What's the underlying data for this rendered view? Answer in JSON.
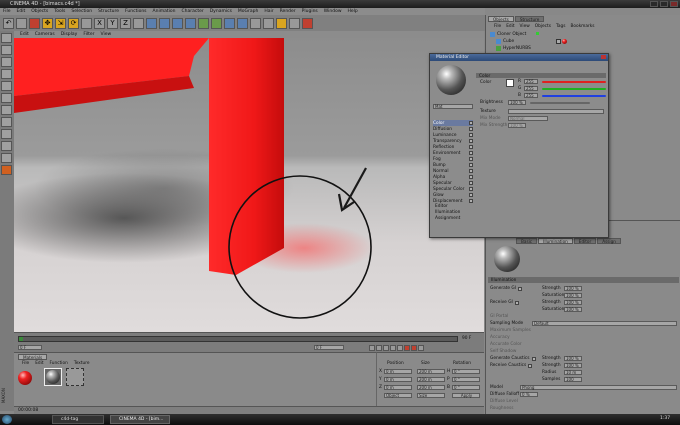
{
  "window": {
    "title": "CINEMA 4D - [bimacs.c4d *]"
  },
  "menu": [
    "File",
    "Edit",
    "Objects",
    "Tools",
    "Selection",
    "Structure",
    "Functions",
    "Animation",
    "Character",
    "Dynamics",
    "MoGraph",
    "Hair",
    "Render",
    "Plugins",
    "Window",
    "Help"
  ],
  "toolbar_glyphs": {
    "undo": "↶",
    "move": "✥",
    "scale": "⇲",
    "rotate": "⟳",
    "x": "X",
    "y": "Y",
    "z": "Z"
  },
  "viewport": {
    "menu": [
      "Edit",
      "Cameras",
      "Display",
      "Filter",
      "View"
    ]
  },
  "object_manager": {
    "tabs": [
      "Objects",
      "Structure"
    ],
    "menu": [
      "File",
      "Edit",
      "View",
      "Objects",
      "Tags",
      "Bookmarks"
    ],
    "items": [
      {
        "label": "Cloner Object"
      },
      {
        "label": "Cube"
      },
      {
        "label": "HyperNURBS"
      }
    ]
  },
  "material_editor": {
    "title": "Material Editor",
    "section": "Color",
    "color_label": "Color",
    "channels": [
      {
        "label": "R",
        "value": "255"
      },
      {
        "label": "G",
        "value": "255"
      },
      {
        "label": "B",
        "value": "255"
      }
    ],
    "brightness_label": "Brightness",
    "brightness_value": "100 %",
    "texture_label": "Texture",
    "mix_mode_label": "Mix Mode",
    "mix_mode_value": "Normal",
    "mix_strength_label": "Mix Strength",
    "mix_strength_value": "100 %",
    "material_name": "Mat",
    "list": [
      "Color",
      "Diffusion",
      "Luminance",
      "Transparency",
      "Reflection",
      "Environment",
      "Fog",
      "Bump",
      "Normal",
      "Alpha",
      "Specular",
      "Specular Color",
      "Glow",
      "Displacement",
      "Editor",
      "Illumination",
      "Assignment"
    ],
    "colors": {
      "red": "#e02020",
      "green": "#20b020",
      "blue": "#2040e0"
    }
  },
  "attributes": {
    "tabs": [
      "Basic",
      "Illumination",
      "Editor",
      "Assign"
    ],
    "section": "Illumination",
    "generate_gi": "Generate GI",
    "receive_gi": "Receive GI",
    "strength": "Strength",
    "saturation": "Saturation",
    "pct": "100 %",
    "gi_portal": "GI Portal",
    "sampling_mode": "Sampling Mode",
    "sampling_value": "Default",
    "max_samples": "Maximum Samples",
    "accuracy": "Accuracy",
    "accurate_color": "Accurate Color",
    "self_shadow": "Self Shadow",
    "gen_caustics": "Generate Caustics",
    "rec_caustics": "Receive Caustics",
    "radius": "Radius",
    "radius_value": "10 m",
    "samples": "Samples",
    "samples_value": "100",
    "model": "Model",
    "model_value": "Phong",
    "diffuse_falloff": "Diffuse Falloff",
    "diffuse_falloff_value": "0 %",
    "diffuse_level": "Diffuse Level",
    "roughness": "Roughness"
  },
  "timeline": {
    "start": "0 F",
    "end": "90 F",
    "current": "0 F"
  },
  "materials": {
    "tab": "Materials",
    "menu": [
      "File",
      "Edit",
      "Function",
      "Texture"
    ]
  },
  "coords": {
    "headers": [
      "Position",
      "Size",
      "Rotation"
    ],
    "axes": [
      "X",
      "Y",
      "Z"
    ],
    "pos_vals": [
      "0 m",
      "0 m",
      "0 m"
    ],
    "size_vals": [
      "200 m",
      "200 m",
      "200 m"
    ],
    "rot_vals": [
      "H",
      "P",
      "B"
    ],
    "rot_values": [
      "0 °",
      "0 °",
      "0 °"
    ],
    "apply": "Apply",
    "mode": "Object",
    "size_mode": "Size"
  },
  "status": {
    "time": "00:00:08"
  },
  "taskbar": {
    "items": [
      "c4d-tag",
      "CINEMA 4D - [bim..."
    ],
    "clock": "1:37"
  },
  "side_label": "MAXON"
}
